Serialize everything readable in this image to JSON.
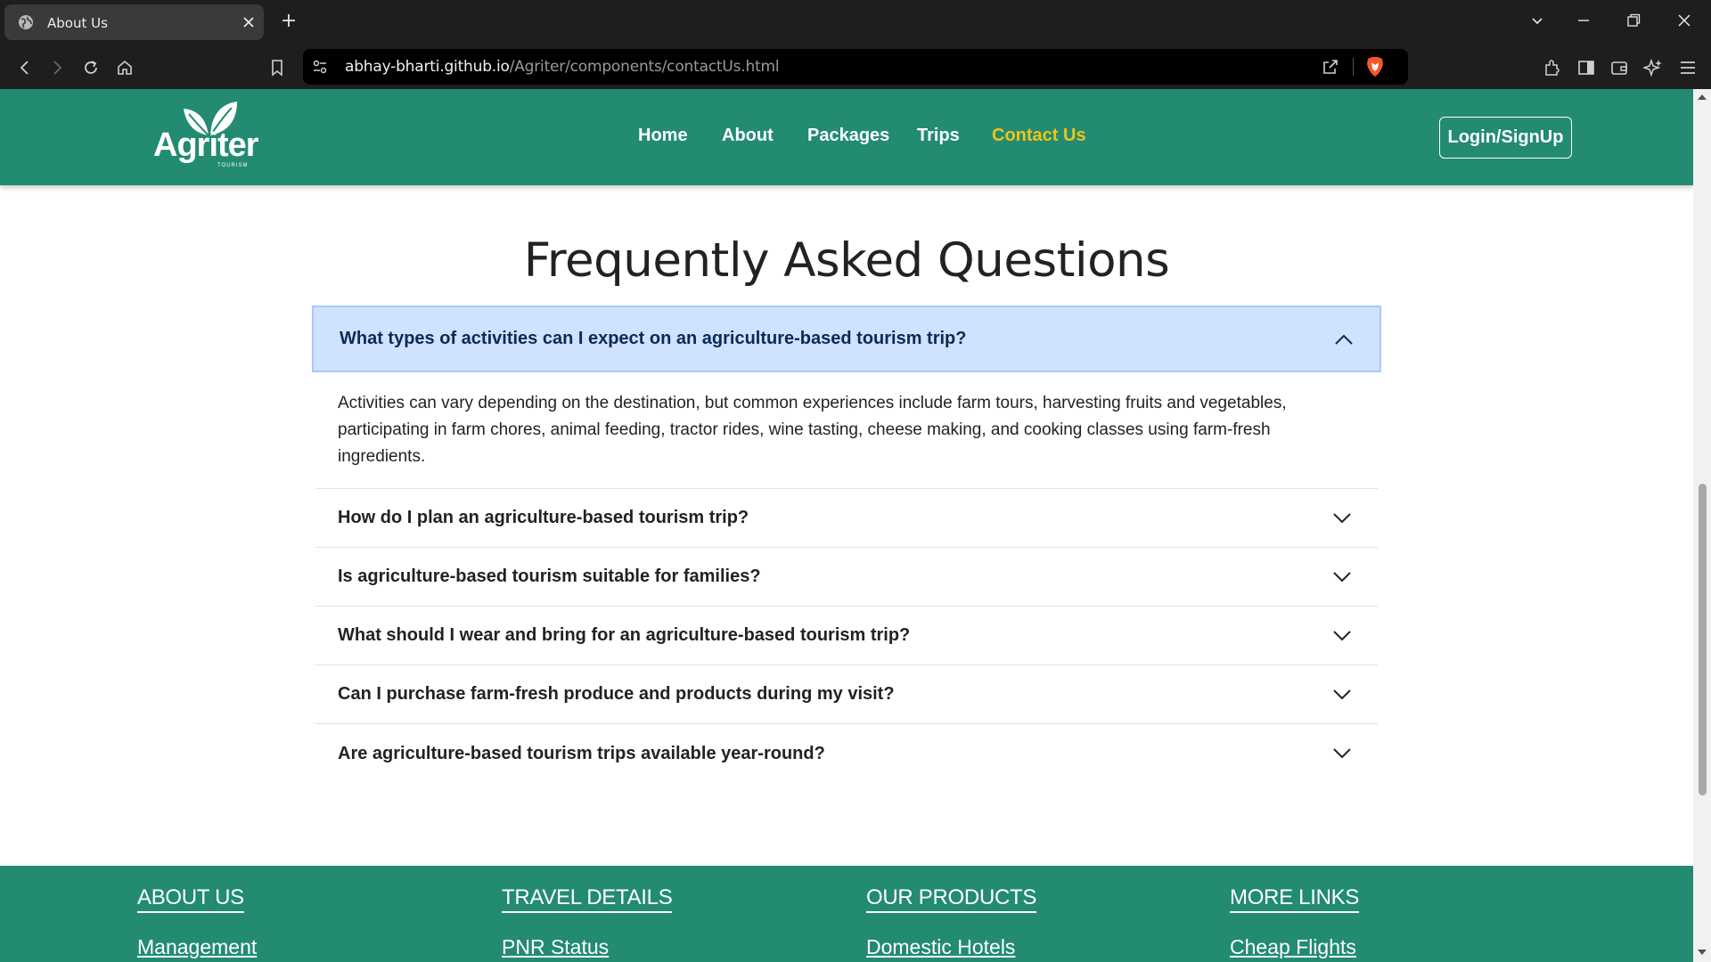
{
  "browser": {
    "tab_title": "About Us",
    "url_host": "abhay-bharti.github.io",
    "url_path": "/Agriter/components/contactUs.html"
  },
  "site": {
    "logo_text": "Agriter",
    "logo_sub": "TOURISM",
    "nav": [
      {
        "label": "Home"
      },
      {
        "label": "About"
      },
      {
        "label": "Packages"
      },
      {
        "label": "Trips"
      },
      {
        "label": "Contact Us",
        "active": true
      }
    ],
    "login_label": "Login/SignUp",
    "brand_color": "#228b72",
    "active_color": "#f0c419"
  },
  "faq": {
    "title": "Frequently Asked Questions",
    "open_question": "What types of activities can I expect on an agriculture-based tourism trip?",
    "open_answer": "Activities can vary depending on the destination, but common experiences include farm tours, harvesting fruits and vegetables, participating in farm chores, animal feeding, tractor rides, wine tasting, cheese making, and cooking classes using farm-fresh ingredients.",
    "questions": [
      "How do I plan an agriculture-based tourism trip?",
      "Is agriculture-based tourism suitable for families?",
      "What should I wear and bring for an agriculture-based tourism trip?",
      "Can I purchase farm-fresh produce and products during my visit?",
      "Are agriculture-based tourism trips available year-round?"
    ]
  },
  "footer": {
    "columns": [
      {
        "heading": "ABOUT US",
        "first_link": "Management"
      },
      {
        "heading": "TRAVEL DETAILS",
        "first_link": "PNR Status"
      },
      {
        "heading": "OUR PRODUCTS",
        "first_link": "Domestic Hotels"
      },
      {
        "heading": "MORE LINKS",
        "first_link": "Cheap Flights"
      }
    ]
  }
}
